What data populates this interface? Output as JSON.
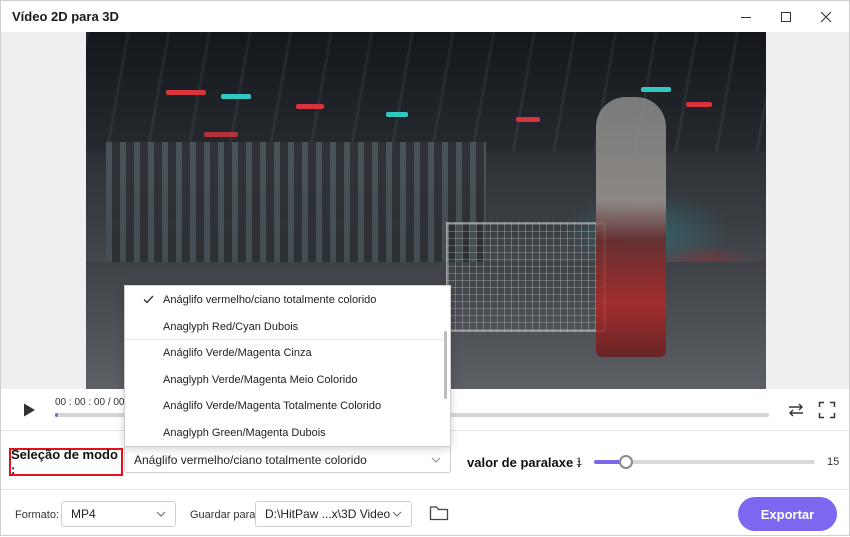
{
  "window": {
    "title": "Vídeo 2D para 3D"
  },
  "player": {
    "timecode": "00 : 00 : 00 / 00 :",
    "progress_fraction": 0.004
  },
  "mode": {
    "label": "Seleção de modo :",
    "selected": "Anáglifo vermelho/ciano totalmente colorido",
    "options": [
      "Anáglifo vermelho/ciano totalmente colorido",
      "Anaglyph Red/Cyan Dubois",
      "Anáglifo Verde/Magenta Cinza",
      "Anaglyph Verde/Magenta Meio Colorido",
      "Anáglifo Verde/Magenta Totalmente Colorido",
      "Anaglyph Green/Magenta Dubois"
    ],
    "checked_index": 0
  },
  "parallax": {
    "label": "valor de paralaxe :",
    "min_label": "1",
    "max_label": "15",
    "min": 1,
    "max": 15,
    "value": 3
  },
  "output": {
    "format_label": "Formato:",
    "format_value": "MP4",
    "save_label": "Guardar para:",
    "save_value": "D:\\HitPaw ...x\\3D Video",
    "export_label": "Exportar"
  },
  "colors": {
    "accent": "#7b67f0",
    "highlight_border": "#e0121b"
  },
  "icons": {
    "play": "play-icon",
    "swap": "swap-icon",
    "fullscreen": "fullscreen-icon",
    "folder": "folder-icon",
    "check": "check-icon",
    "chevron": "chevron-down-icon"
  }
}
